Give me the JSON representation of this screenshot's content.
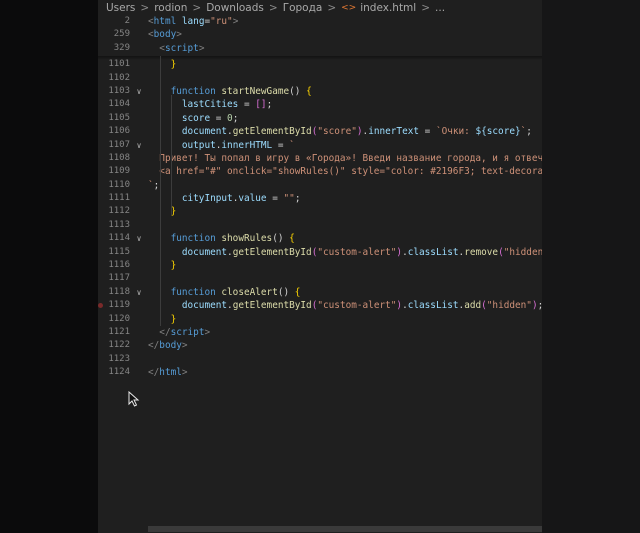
{
  "breadcrumb": {
    "items": [
      "Users",
      "rodion",
      "Downloads",
      "Города",
      "index.html",
      "..."
    ],
    "separator": ">",
    "file_icon": "html-file-icon"
  },
  "colors": {
    "editor_background": "#1f1f1f",
    "tag": "#569cd6",
    "string": "#ce9178",
    "function": "#dcdcaa",
    "variable": "#9cdcfe",
    "number": "#b5cea8",
    "line_number": "#858585"
  },
  "lines": [
    {
      "num": "2",
      "tokens": [
        {
          "t": "<",
          "c": "punc"
        },
        {
          "t": "html",
          "c": "tag"
        },
        {
          "t": " ",
          "c": "plain"
        },
        {
          "t": "lang",
          "c": "attr"
        },
        {
          "t": "=",
          "c": "plain"
        },
        {
          "t": "\"ru\"",
          "c": "str"
        },
        {
          "t": ">",
          "c": "punc"
        }
      ]
    },
    {
      "num": "259",
      "tokens": [
        {
          "t": "<",
          "c": "punc"
        },
        {
          "t": "body",
          "c": "tag"
        },
        {
          "t": ">",
          "c": "punc"
        }
      ]
    },
    {
      "num": "329",
      "tokens": [
        {
          "t": "  ",
          "c": "plain"
        },
        {
          "t": "<",
          "c": "punc"
        },
        {
          "t": "script",
          "c": "tag"
        },
        {
          "t": ">",
          "c": "punc"
        }
      ]
    },
    {
      "num": "1101",
      "tokens": [
        {
          "t": "    ",
          "c": "plain"
        },
        {
          "t": "}",
          "c": "brace"
        }
      ]
    },
    {
      "num": "1102",
      "tokens": []
    },
    {
      "num": "1103",
      "fold": true,
      "tokens": [
        {
          "t": "    ",
          "c": "plain"
        },
        {
          "t": "function",
          "c": "kw"
        },
        {
          "t": " ",
          "c": "plain"
        },
        {
          "t": "startNewGame",
          "c": "fn"
        },
        {
          "t": "() ",
          "c": "plain"
        },
        {
          "t": "{",
          "c": "brace"
        }
      ]
    },
    {
      "num": "1104",
      "tokens": [
        {
          "t": "      ",
          "c": "plain"
        },
        {
          "t": "lastCities",
          "c": "var"
        },
        {
          "t": " = ",
          "c": "plain"
        },
        {
          "t": "[]",
          "c": "brace2"
        },
        {
          "t": ";",
          "c": "plain"
        }
      ]
    },
    {
      "num": "1105",
      "tokens": [
        {
          "t": "      ",
          "c": "plain"
        },
        {
          "t": "score",
          "c": "var"
        },
        {
          "t": " = ",
          "c": "plain"
        },
        {
          "t": "0",
          "c": "num"
        },
        {
          "t": ";",
          "c": "plain"
        }
      ]
    },
    {
      "num": "1106",
      "tokens": [
        {
          "t": "      ",
          "c": "plain"
        },
        {
          "t": "document",
          "c": "var"
        },
        {
          "t": ".",
          "c": "plain"
        },
        {
          "t": "getElementById",
          "c": "fn"
        },
        {
          "t": "(",
          "c": "brace2"
        },
        {
          "t": "\"score\"",
          "c": "str"
        },
        {
          "t": ")",
          "c": "brace2"
        },
        {
          "t": ".",
          "c": "plain"
        },
        {
          "t": "innerText",
          "c": "var"
        },
        {
          "t": " = ",
          "c": "plain"
        },
        {
          "t": "`Очки: ",
          "c": "tpl"
        },
        {
          "t": "${score}",
          "c": "tplx"
        },
        {
          "t": "`",
          "c": "tpl"
        },
        {
          "t": ";",
          "c": "plain"
        }
      ]
    },
    {
      "num": "1107",
      "fold": true,
      "tokens": [
        {
          "t": "      ",
          "c": "plain"
        },
        {
          "t": "output",
          "c": "var"
        },
        {
          "t": ".",
          "c": "plain"
        },
        {
          "t": "innerHTML",
          "c": "var"
        },
        {
          "t": " = ",
          "c": "plain"
        },
        {
          "t": "`",
          "c": "tpl"
        }
      ]
    },
    {
      "num": "1108",
      "tokens": [
        {
          "t": "  ",
          "c": "plain"
        },
        {
          "t": "Привет! Ты попал в игру в «Города»! Введи название города, и я отвечу",
          "c": "ru"
        }
      ]
    },
    {
      "num": "1109",
      "tokens": [
        {
          "t": "  ",
          "c": "plain"
        },
        {
          "t": "<a href=\"#\" onclick=\"showRules()\" style=\"color: #2196F3; text-decorati",
          "c": "ru"
        }
      ]
    },
    {
      "num": "1110",
      "tokens": [
        {
          "t": "`",
          "c": "tpl"
        },
        {
          "t": ";",
          "c": "plain"
        }
      ]
    },
    {
      "num": "1111",
      "tokens": [
        {
          "t": "      ",
          "c": "plain"
        },
        {
          "t": "cityInput",
          "c": "var"
        },
        {
          "t": ".",
          "c": "plain"
        },
        {
          "t": "value",
          "c": "var"
        },
        {
          "t": " = ",
          "c": "plain"
        },
        {
          "t": "\"\"",
          "c": "str"
        },
        {
          "t": ";",
          "c": "plain"
        }
      ]
    },
    {
      "num": "1112",
      "tokens": [
        {
          "t": "    ",
          "c": "plain"
        },
        {
          "t": "}",
          "c": "brace"
        }
      ]
    },
    {
      "num": "1113",
      "tokens": []
    },
    {
      "num": "1114",
      "fold": true,
      "tokens": [
        {
          "t": "    ",
          "c": "plain"
        },
        {
          "t": "function",
          "c": "kw"
        },
        {
          "t": " ",
          "c": "plain"
        },
        {
          "t": "showRules",
          "c": "fn"
        },
        {
          "t": "() ",
          "c": "plain"
        },
        {
          "t": "{",
          "c": "brace"
        }
      ]
    },
    {
      "num": "1115",
      "tokens": [
        {
          "t": "      ",
          "c": "plain"
        },
        {
          "t": "document",
          "c": "var"
        },
        {
          "t": ".",
          "c": "plain"
        },
        {
          "t": "getElementById",
          "c": "fn"
        },
        {
          "t": "(",
          "c": "brace2"
        },
        {
          "t": "\"custom-alert\"",
          "c": "str"
        },
        {
          "t": ")",
          "c": "brace2"
        },
        {
          "t": ".",
          "c": "plain"
        },
        {
          "t": "classList",
          "c": "var"
        },
        {
          "t": ".",
          "c": "plain"
        },
        {
          "t": "remove",
          "c": "fn"
        },
        {
          "t": "(",
          "c": "brace2"
        },
        {
          "t": "\"hidden\"",
          "c": "str"
        },
        {
          "t": ")",
          "c": "brace2"
        },
        {
          "t": ";",
          "c": "plain"
        }
      ]
    },
    {
      "num": "1116",
      "tokens": [
        {
          "t": "    ",
          "c": "plain"
        },
        {
          "t": "}",
          "c": "brace"
        }
      ]
    },
    {
      "num": "1117",
      "tokens": []
    },
    {
      "num": "1118",
      "fold": true,
      "tokens": [
        {
          "t": "    ",
          "c": "plain"
        },
        {
          "t": "function",
          "c": "kw"
        },
        {
          "t": " ",
          "c": "plain"
        },
        {
          "t": "closeAlert",
          "c": "fn"
        },
        {
          "t": "() ",
          "c": "plain"
        },
        {
          "t": "{",
          "c": "brace"
        }
      ]
    },
    {
      "num": "1119",
      "breakpoint": true,
      "tokens": [
        {
          "t": "      ",
          "c": "plain"
        },
        {
          "t": "document",
          "c": "var"
        },
        {
          "t": ".",
          "c": "plain"
        },
        {
          "t": "getElementById",
          "c": "fn"
        },
        {
          "t": "(",
          "c": "brace2"
        },
        {
          "t": "\"custom-alert\"",
          "c": "str"
        },
        {
          "t": ")",
          "c": "brace2"
        },
        {
          "t": ".",
          "c": "plain"
        },
        {
          "t": "classList",
          "c": "var"
        },
        {
          "t": ".",
          "c": "plain"
        },
        {
          "t": "add",
          "c": "fn"
        },
        {
          "t": "(",
          "c": "brace2"
        },
        {
          "t": "\"hidden\"",
          "c": "str"
        },
        {
          "t": ")",
          "c": "brace2"
        },
        {
          "t": ";",
          "c": "plain"
        }
      ]
    },
    {
      "num": "1120",
      "tokens": [
        {
          "t": "    ",
          "c": "plain"
        },
        {
          "t": "}",
          "c": "brace"
        }
      ]
    },
    {
      "num": "1121",
      "tokens": [
        {
          "t": "  ",
          "c": "plain"
        },
        {
          "t": "</",
          "c": "punc"
        },
        {
          "t": "script",
          "c": "tag"
        },
        {
          "t": ">",
          "c": "punc"
        }
      ]
    },
    {
      "num": "1122",
      "tokens": [
        {
          "t": "</",
          "c": "punc"
        },
        {
          "t": "body",
          "c": "tag"
        },
        {
          "t": ">",
          "c": "punc"
        }
      ]
    },
    {
      "num": "1123",
      "tokens": []
    },
    {
      "num": "1124",
      "tokens": [
        {
          "t": "</",
          "c": "punc"
        },
        {
          "t": "html",
          "c": "tag"
        },
        {
          "t": ">",
          "c": "punc"
        }
      ]
    }
  ]
}
